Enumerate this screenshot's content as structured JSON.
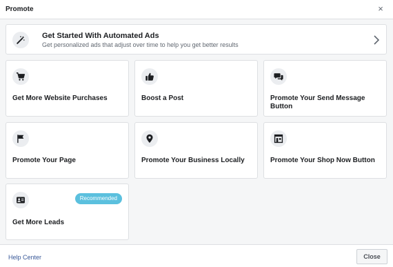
{
  "header": {
    "title": "Promote",
    "close_glyph": "×"
  },
  "automated": {
    "title": "Get Started With Automated Ads",
    "subtitle": "Get personalized ads that adjust over time to help you get better results",
    "icon": "magic-wand-icon"
  },
  "cards": [
    {
      "label": "Get More Website Purchases",
      "icon": "shopping-cart-icon"
    },
    {
      "label": "Boost a Post",
      "icon": "thumbs-up-icon"
    },
    {
      "label": "Promote Your Send Message Button",
      "icon": "chat-bubbles-icon"
    },
    {
      "label": "Promote Your Page",
      "icon": "flag-icon"
    },
    {
      "label": "Promote Your Business Locally",
      "icon": "location-pin-icon"
    },
    {
      "label": "Promote Your Shop Now Button",
      "icon": "storefront-icon"
    },
    {
      "label": "Get More Leads",
      "icon": "contact-card-icon",
      "badge": "Recommended"
    }
  ],
  "footer": {
    "help_label": "Help Center",
    "close_label": "Close"
  },
  "colors": {
    "badge": "#5bc0de",
    "link": "#385898",
    "background": "#f5f6f7"
  }
}
